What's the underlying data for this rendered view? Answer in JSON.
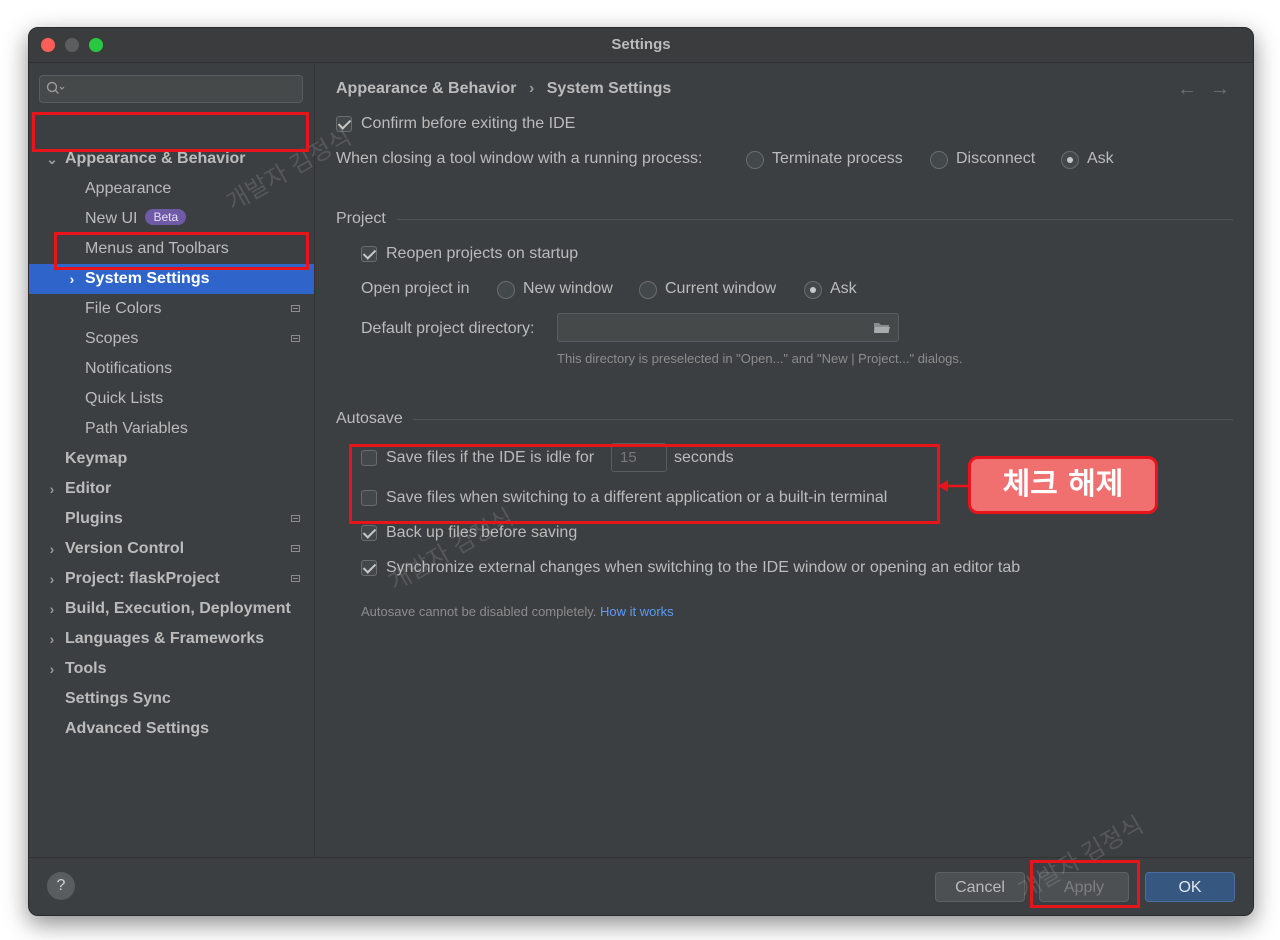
{
  "window": {
    "title": "Settings"
  },
  "sidebar": {
    "search_placeholder": "",
    "items": [
      {
        "label": "Appearance & Behavior"
      },
      {
        "label": "Appearance"
      },
      {
        "label": "New UI",
        "badge": "Beta"
      },
      {
        "label": "Menus and Toolbars"
      },
      {
        "label": "System Settings"
      },
      {
        "label": "File Colors"
      },
      {
        "label": "Scopes"
      },
      {
        "label": "Notifications"
      },
      {
        "label": "Quick Lists"
      },
      {
        "label": "Path Variables"
      },
      {
        "label": "Keymap"
      },
      {
        "label": "Editor"
      },
      {
        "label": "Plugins"
      },
      {
        "label": "Version Control"
      },
      {
        "label": "Project: flaskProject"
      },
      {
        "label": "Build, Execution, Deployment"
      },
      {
        "label": "Languages & Frameworks"
      },
      {
        "label": "Tools"
      },
      {
        "label": "Settings Sync"
      },
      {
        "label": "Advanced Settings"
      }
    ]
  },
  "main": {
    "breadcrumb": {
      "parent": "Appearance & Behavior",
      "separator": "›",
      "current": "System Settings"
    },
    "nav": {
      "back": "←",
      "forward": "→"
    },
    "confirm_exit": {
      "label": "Confirm before exiting the IDE",
      "checked": true
    },
    "closing_tool_window": {
      "label": "When closing a tool window with a running process:",
      "options": [
        "Terminate process",
        "Disconnect",
        "Ask"
      ],
      "selected": "Ask"
    },
    "project": {
      "section_title": "Project",
      "reopen": {
        "label": "Reopen projects on startup",
        "checked": true
      },
      "open_in": {
        "label": "Open project in",
        "options": [
          "New window",
          "Current window",
          "Ask"
        ],
        "selected": "Ask"
      },
      "default_dir": {
        "label": "Default project directory:",
        "value": "",
        "hint": "This directory is preselected in \"Open...\" and \"New | Project...\" dialogs."
      }
    },
    "autosave": {
      "section_title": "Autosave",
      "idle": {
        "label_before": "Save files if the IDE is idle for",
        "value": "15",
        "label_after": "seconds",
        "checked": false
      },
      "switching": {
        "label": "Save files when switching to a different application or a built-in terminal",
        "checked": false
      },
      "backup": {
        "label": "Back up files before saving",
        "checked": true
      },
      "sync": {
        "label": "Synchronize external changes when switching to the IDE window or opening an editor tab",
        "checked": true
      },
      "note": "Autosave cannot be disabled completely.",
      "link": "How it works"
    }
  },
  "annotation": {
    "callout": "체크 해제"
  },
  "watermark": "개발자 김정식",
  "footer": {
    "help": "?",
    "cancel": "Cancel",
    "apply": "Apply",
    "ok": "OK"
  },
  "colors": {
    "accent": "#2f65ca",
    "annotation_red": "#e8141c",
    "callout_fill": "#f07070",
    "link": "#589df6"
  }
}
